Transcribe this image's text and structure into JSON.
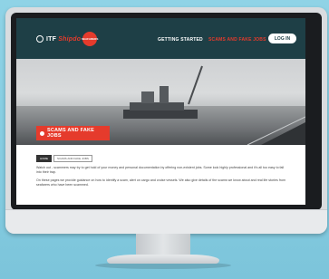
{
  "site": {
    "logo_prefix": "ITF",
    "logo_name": "Shipdo",
    "logo_badge": "SEAFARERS",
    "colors": {
      "nav_bg": "#1e3f46",
      "accent_red": "#e53b2c",
      "white": "#ffffff"
    }
  },
  "nav": {
    "items": [
      {
        "label": "GETTING STARTED"
      },
      {
        "label": "SCAMS AND FAKE JOBS"
      }
    ],
    "login_label": "LOG IN"
  },
  "hero": {
    "banner_label": "SCAMS AND FAKE JOBS"
  },
  "content": {
    "breadcrumbs": [
      "HOME",
      "SCAMS AND FAKE JOBS"
    ],
    "paragraphs": [
      "Watch out - scammers may try to get hold of your money and personal documentation by offering non-existent jobs. Some look highly professional and it's all too easy to fall into their trap.",
      "On these pages we provide guidance on how to identify a scam, alert on cargo and cruise vessels. We also give details of the scams we know about and real life stories from seafarers who have been scammed."
    ]
  }
}
